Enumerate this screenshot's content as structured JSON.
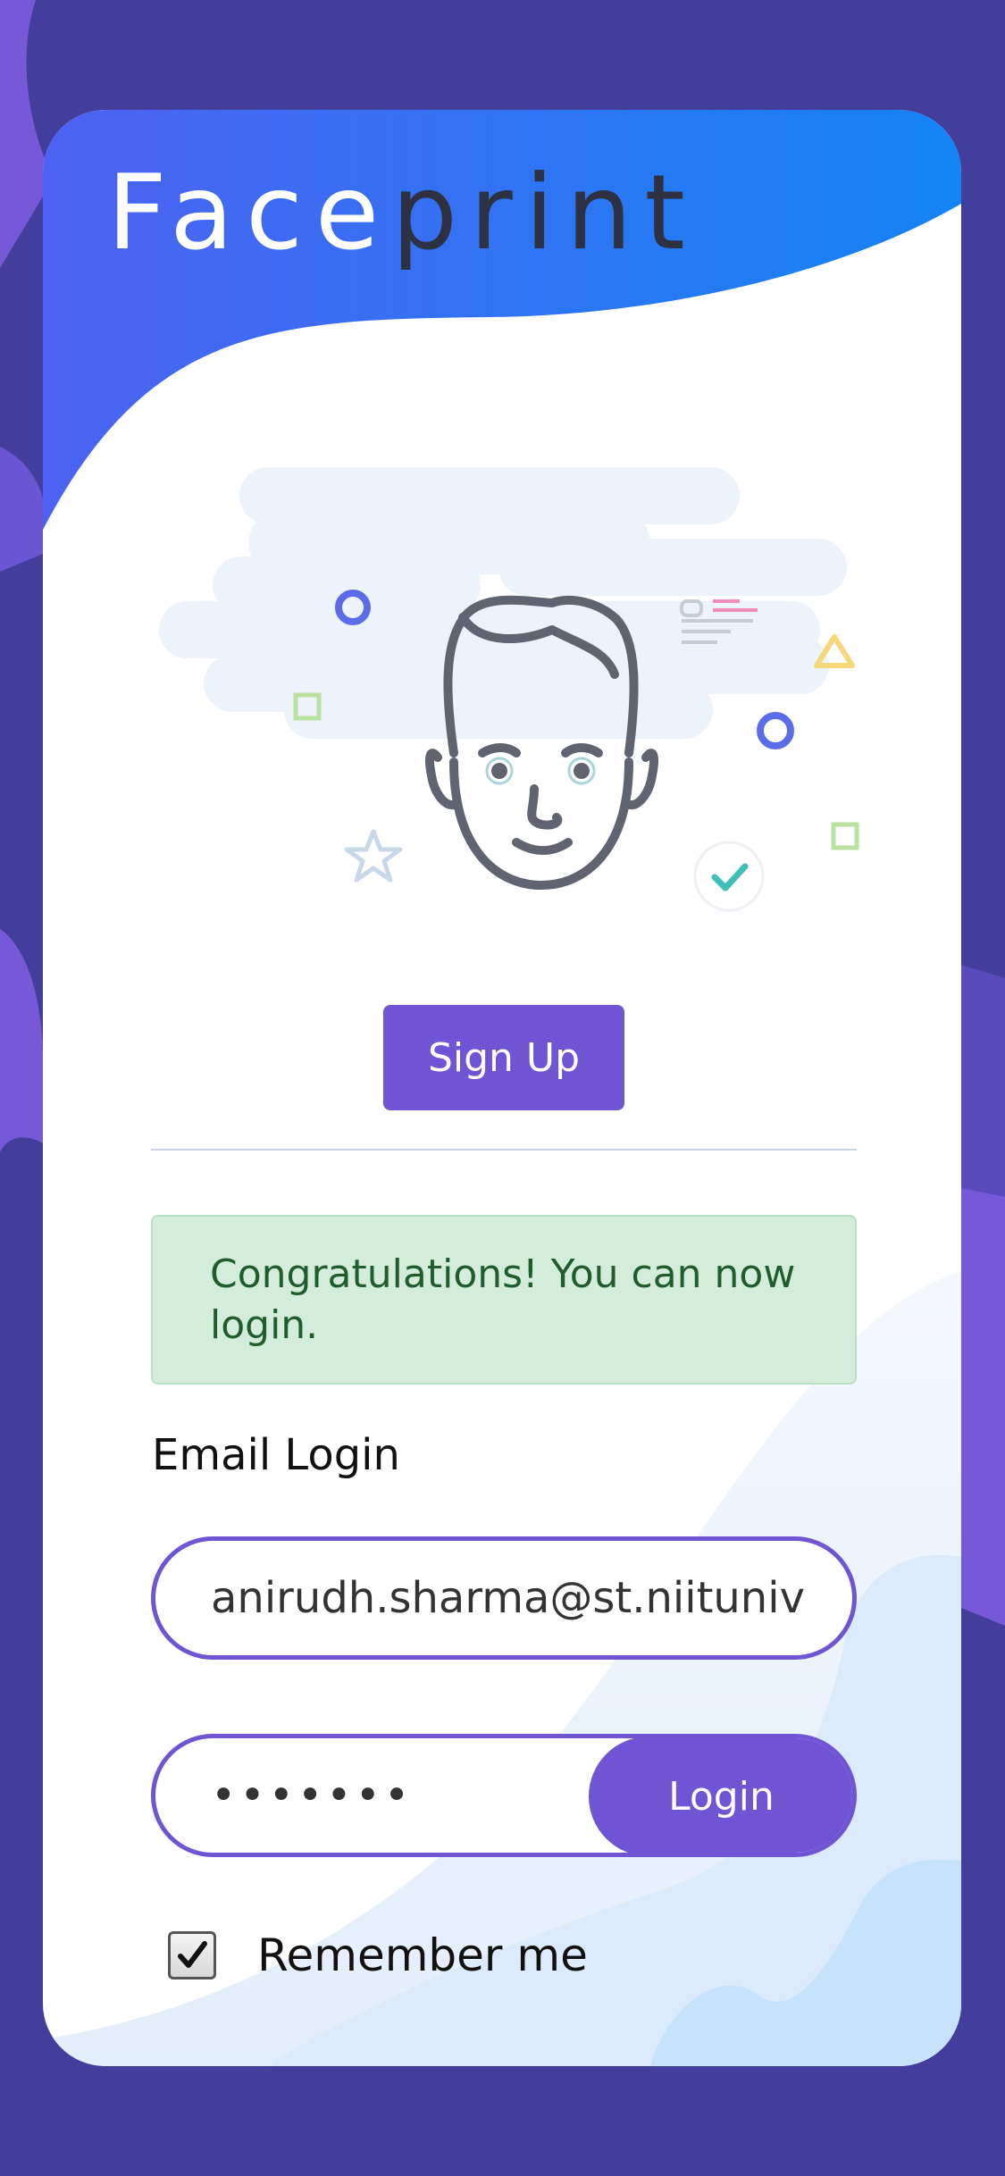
{
  "brand": {
    "part_light": "Face",
    "part_dark": "print"
  },
  "illustration": {
    "icon": "face-scan-illustration"
  },
  "signup": {
    "label": "Sign Up"
  },
  "alert": {
    "message": "Congratulations! You can now login."
  },
  "email_login": {
    "heading": "Email Login",
    "email_value": "anirudh.sharma@st.niituniv",
    "password_value": "•••••••",
    "login_label": "Login",
    "remember_label": "Remember me",
    "remember_checked": true
  },
  "colors": {
    "background": "#433d9b",
    "accent": "#6f54d4",
    "header_blue": "#1d7cf5",
    "alert_bg": "#d4eddb",
    "alert_text": "#1f5d2c"
  }
}
